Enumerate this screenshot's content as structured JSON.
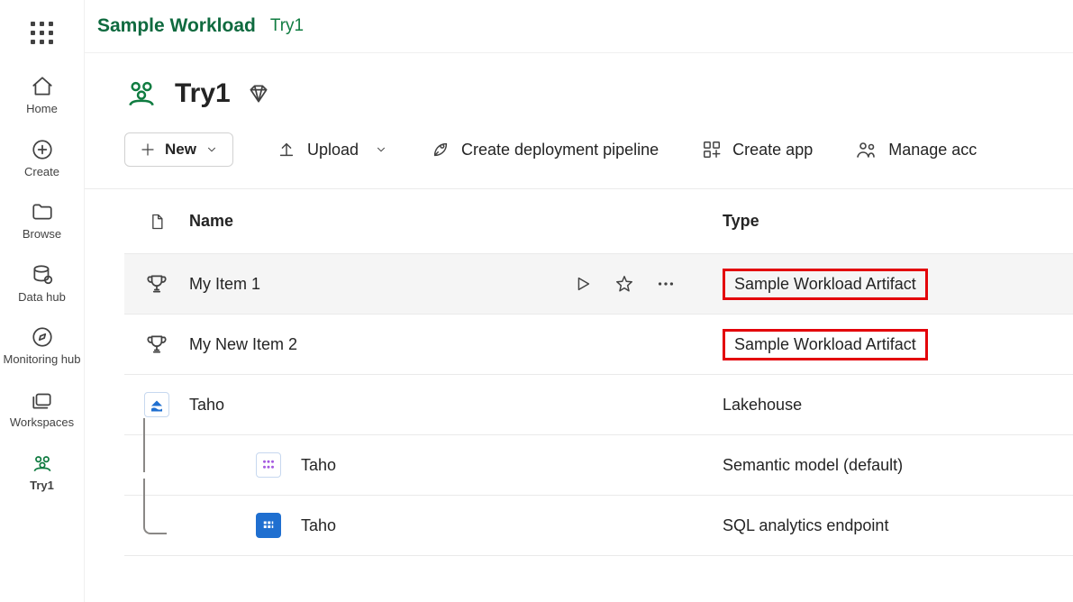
{
  "header": {
    "brand": "Sample Workload",
    "breadcrumb": "Try1"
  },
  "nav": {
    "home": "Home",
    "create": "Create",
    "browse": "Browse",
    "datahub": "Data hub",
    "monitoring": "Monitoring hub",
    "workspaces": "Workspaces",
    "active": "Try1"
  },
  "workspace": {
    "title": "Try1"
  },
  "toolbar": {
    "new_label": "New",
    "upload_label": "Upload",
    "pipeline_label": "Create deployment pipeline",
    "create_app_label": "Create app",
    "manage_label": "Manage acc"
  },
  "table": {
    "headers": {
      "name": "Name",
      "type": "Type"
    },
    "rows": [
      {
        "name": "My Item 1",
        "type": "Sample Workload Artifact",
        "icon": "trophy",
        "highlight": true,
        "hover": true,
        "child": false
      },
      {
        "name": "My New Item 2",
        "type": "Sample Workload Artifact",
        "icon": "trophy",
        "highlight": true,
        "hover": false,
        "child": false
      },
      {
        "name": "Taho",
        "type": "Lakehouse",
        "icon": "lakehouse",
        "highlight": false,
        "hover": false,
        "child": false
      },
      {
        "name": "Taho",
        "type": "Semantic model (default)",
        "icon": "semantic",
        "highlight": false,
        "hover": false,
        "child": true
      },
      {
        "name": "Taho",
        "type": "SQL analytics endpoint",
        "icon": "sql",
        "highlight": false,
        "hover": false,
        "child": true
      }
    ]
  }
}
